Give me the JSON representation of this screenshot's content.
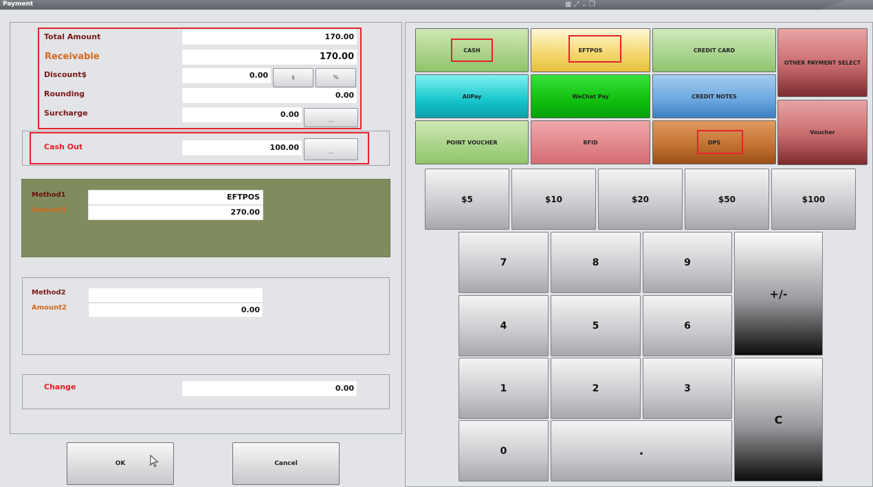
{
  "window": {
    "title": "Payment",
    "icons": [
      "grid-icon",
      "expand-icon",
      "chevron-down-icon",
      "restore-icon"
    ]
  },
  "totals": {
    "total_amount_label": "Total Amount",
    "total_amount_value": "170.00",
    "receivable_label": "Receivable",
    "receivable_value": "170.00",
    "discount_label": "Discount$",
    "discount_value": "0.00",
    "discount_dollar_btn": "$",
    "discount_pct_btn": "%",
    "rounding_label": "Rounding",
    "rounding_value": "0.00",
    "surcharge_label": "Surcharge",
    "surcharge_value": "0.00",
    "surcharge_btn": "..."
  },
  "cashout": {
    "label": "Cash Out",
    "value": "100.00",
    "btn": "..."
  },
  "method1": {
    "method_label": "Method1",
    "method_value": "EFTPOS",
    "amount_label": "Amount1",
    "amount_value": "270.00"
  },
  "method2": {
    "method_label": "Method2",
    "method_value": "",
    "amount_label": "Amount2",
    "amount_value": "0.00"
  },
  "change": {
    "label": "Change",
    "value": "0.00"
  },
  "actions": {
    "ok": "OK",
    "cancel": "Cancel"
  },
  "payment_methods": {
    "cash": "CASH",
    "eftpos": "EFTPOS",
    "credit_card": "CREDIT CARD",
    "other": "OTHER PAYMENT SELECT",
    "alipay": "AliPay",
    "wechat": "WeChat Pay",
    "credit_notes": "CREDIT NOTES",
    "point_voucher": "POINT VOUCHER",
    "rfid": "RFID",
    "dps": "DPS",
    "voucher": "Voucher"
  },
  "quick_cash": [
    "$5",
    "$10",
    "$20",
    "$50",
    "$100"
  ],
  "keypad": {
    "k7": "7",
    "k8": "8",
    "k9": "9",
    "k4": "4",
    "k5": "5",
    "k6": "6",
    "k1": "1",
    "k2": "2",
    "k3": "3",
    "k0": "0",
    "dot": ".",
    "plusminus": "+/-",
    "clear": "C"
  },
  "colors": {
    "highlight": "#e8202a",
    "method1_panel": "#818c5e",
    "label": "#7a1818",
    "accent_orange": "#d2691e"
  }
}
